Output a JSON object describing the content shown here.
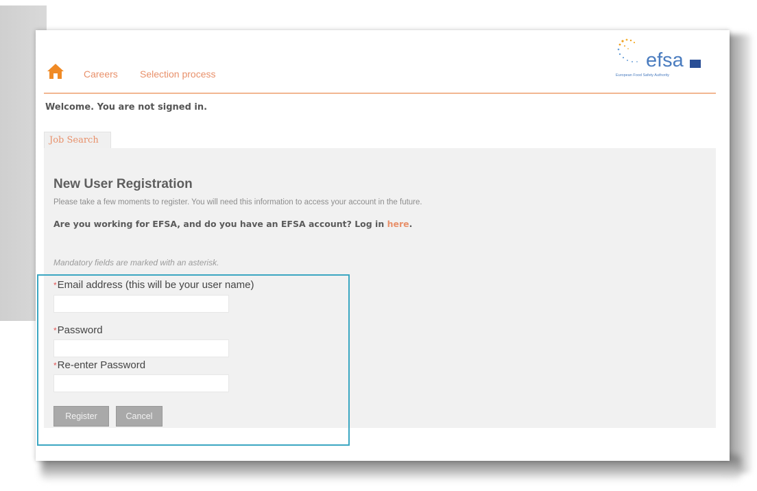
{
  "header": {
    "nav": [
      "Careers",
      "Selection process"
    ],
    "logo": {
      "wordmark": "efsa",
      "tagline": "European Food Safety Authority"
    }
  },
  "welcome_text": "Welcome. You are not signed in.",
  "tabs": [
    {
      "label": "Job Search"
    }
  ],
  "registration": {
    "title": "New User Registration",
    "intro": "Please take a few moments to register. You will need this information to access your account in the future.",
    "efsa_question": "Are you working for EFSA, and do you have an EFSA account? Log in",
    "efsa_link": "here",
    "mandatory_note": "Mandatory fields are marked with an asterisk.",
    "fields": [
      {
        "label": "Email address (this will be your user name)",
        "value": ""
      },
      {
        "label": "Password",
        "value": ""
      },
      {
        "label": "Re-enter Password",
        "value": ""
      }
    ],
    "buttons": {
      "register": "Register",
      "cancel": "Cancel"
    }
  },
  "colors": {
    "accent": "#e8906a",
    "brand_blue": "#4a7cbf",
    "highlight_border": "#3aa6c1",
    "button_gray": "#a9a9a9",
    "required_star": "#e25555"
  },
  "icons": [
    "home-icon",
    "efsa-logo"
  ]
}
